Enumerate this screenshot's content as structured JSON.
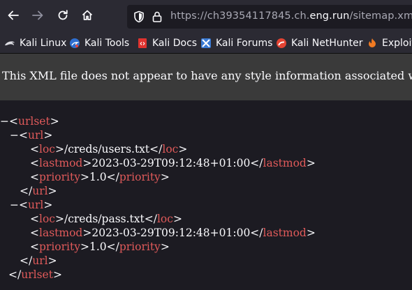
{
  "toolbar": {
    "url_prefix": "https://ch39354117845.ch.",
    "url_domain": "eng.run",
    "url_path": "/sitemap.xml"
  },
  "bookmarks": [
    {
      "label": "Kali Linux",
      "icon": "kali-dragon-icon"
    },
    {
      "label": "Kali Tools",
      "icon": "kali-tools-icon"
    },
    {
      "label": "Kali Docs",
      "icon": "kali-docs-icon"
    },
    {
      "label": "Kali Forums",
      "icon": "kali-forums-icon"
    },
    {
      "label": "Kali NetHunter",
      "icon": "kali-nethunter-icon"
    },
    {
      "label": "Exploit",
      "icon": "exploit-db-icon"
    }
  ],
  "banner": {
    "text": "This XML file does not appear to have any style information associated w"
  },
  "xml": {
    "fold_symbol": "−",
    "lines": [
      {
        "fold": "−",
        "open": "<",
        "tag": "urlset",
        "close": ">"
      },
      {
        "fold": "−",
        "open": "<",
        "tag": "url",
        "close": ">"
      },
      {
        "open": "<",
        "tag": "loc",
        "mid": ">/creds/users.txt</",
        "tag2": "loc",
        "close": ">"
      },
      {
        "open": "<",
        "tag": "lastmod",
        "mid": ">2023-03-29T09:12:48+01:00</",
        "tag2": "lastmod",
        "close": ">"
      },
      {
        "open": "<",
        "tag": "priority",
        "mid": ">1.0</",
        "tag2": "priority",
        "close": ">"
      },
      {
        "open": "</",
        "tag": "url",
        "close": ">"
      },
      {
        "fold": "−",
        "open": "<",
        "tag": "url",
        "close": ">"
      },
      {
        "open": "<",
        "tag": "loc",
        "mid": ">/creds/pass.txt</",
        "tag2": "loc",
        "close": ">"
      },
      {
        "open": "<",
        "tag": "lastmod",
        "mid": ">2023-03-29T09:12:48+01:00</",
        "tag2": "lastmod",
        "close": ">"
      },
      {
        "open": "<",
        "tag": "priority",
        "mid": ">1.0</",
        "tag2": "priority",
        "close": ">"
      },
      {
        "open": "</",
        "tag": "url",
        "close": ">"
      },
      {
        "open": "</",
        "tag": "urlset",
        "close": ">"
      }
    ]
  },
  "colors": {
    "tag": "#e05a5a",
    "background": "#1c1b22",
    "toolbar": "#2b2a33",
    "banner": "#3a3a3a"
  }
}
